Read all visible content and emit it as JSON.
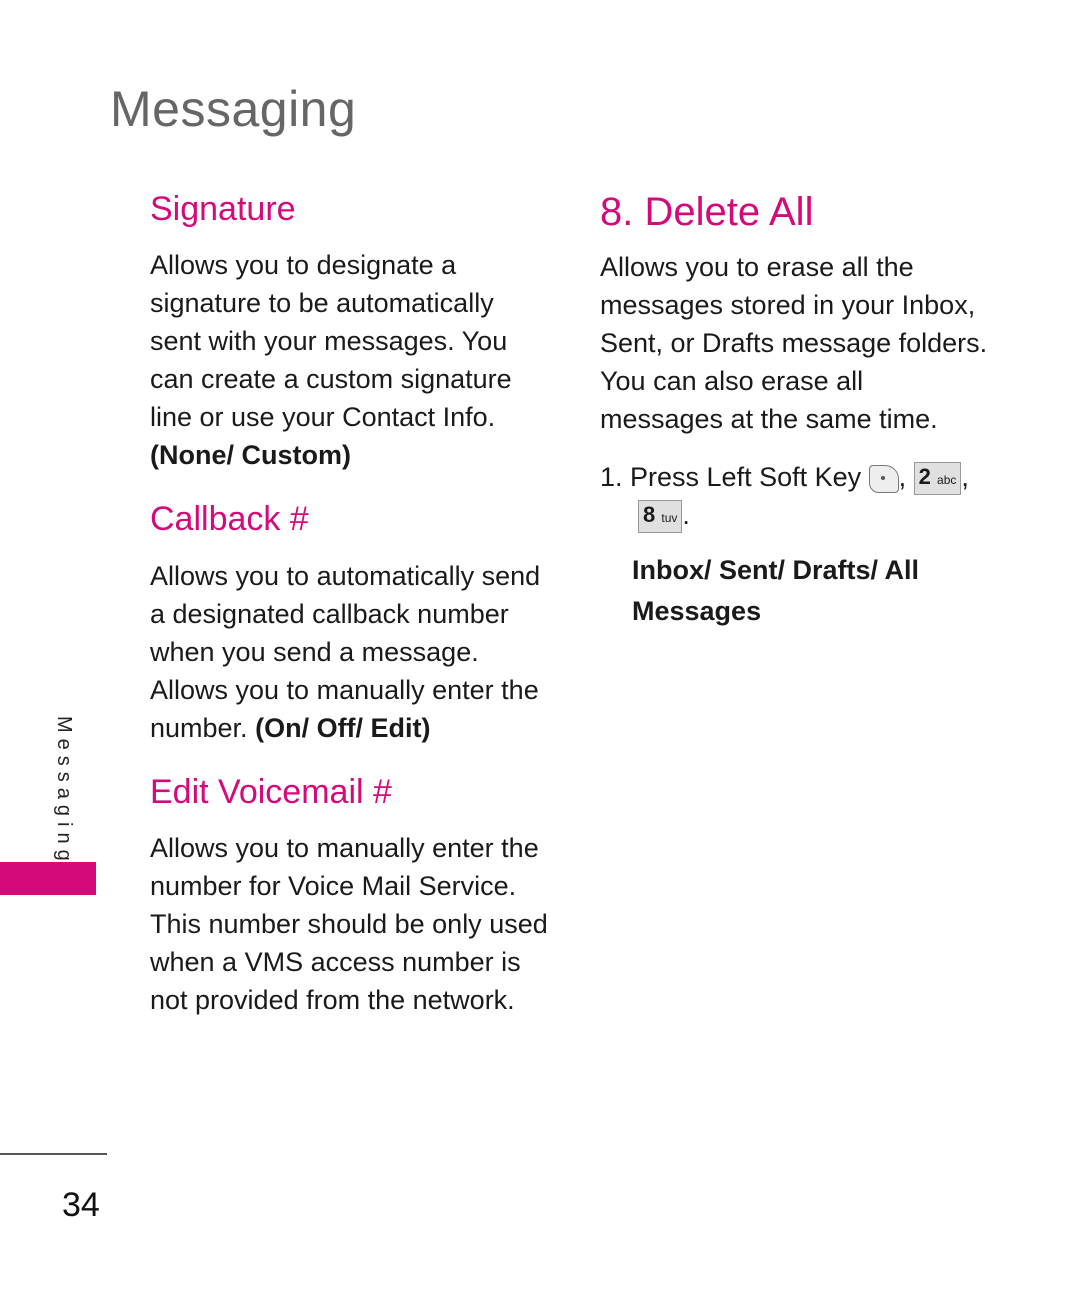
{
  "page_title": "Messaging",
  "side_tab_label": "Messaging",
  "page_number": "34",
  "left": {
    "signature": {
      "heading": "Signature",
      "text": "Allows you to designate a signature to be automatically sent with your messages. You can create a custom signature line or use your Contact Info.",
      "options": "(None/ Custom)"
    },
    "callback": {
      "heading": "Callback #",
      "text": "Allows you to automatically send a designated callback number when you send a message. Allows you to manually enter the number.",
      "options": "(On/ Off/ Edit)"
    },
    "voicemail": {
      "heading": "Edit Voicemail #",
      "text": "Allows you to manually enter the number for Voice Mail Service. This number should be only used when a VMS access number is not provided from the network."
    }
  },
  "right": {
    "heading": "8. Delete All",
    "text": "Allows you to erase all the messages stored in your Inbox, Sent, or Drafts message folders. You can also erase all messages at the same time.",
    "step_prefix": "1. Press Left Soft Key",
    "key1_num": "2",
    "key1_letters": "abc",
    "key2_num": "8",
    "key2_letters": "tuv",
    "options": "Inbox/ Sent/ Drafts/ All Messages"
  }
}
